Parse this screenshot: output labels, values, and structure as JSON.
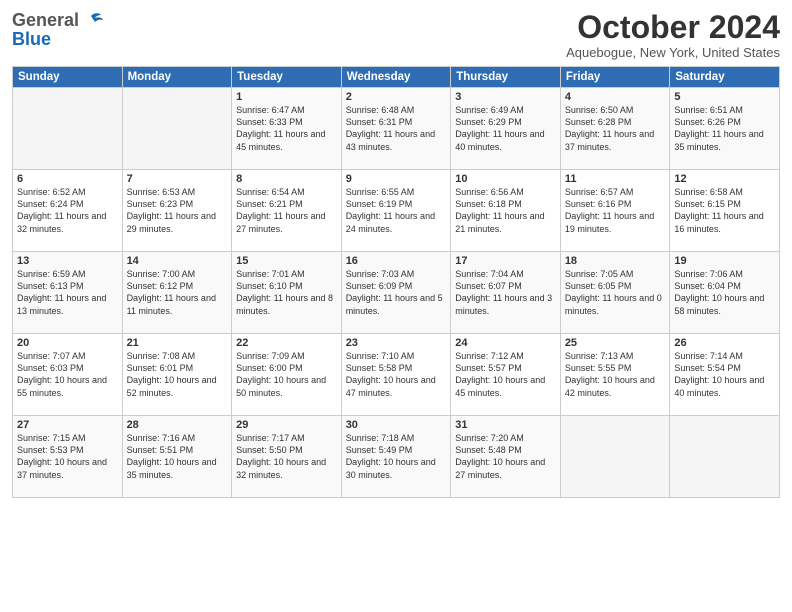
{
  "header": {
    "logo_general": "General",
    "logo_blue": "Blue",
    "month_title": "October 2024",
    "location": "Aquebogue, New York, United States"
  },
  "days_of_week": [
    "Sunday",
    "Monday",
    "Tuesday",
    "Wednesday",
    "Thursday",
    "Friday",
    "Saturday"
  ],
  "weeks": [
    [
      {
        "day": "",
        "sunrise": "",
        "sunset": "",
        "daylight": ""
      },
      {
        "day": "",
        "sunrise": "",
        "sunset": "",
        "daylight": ""
      },
      {
        "day": "1",
        "sunrise": "Sunrise: 6:47 AM",
        "sunset": "Sunset: 6:33 PM",
        "daylight": "Daylight: 11 hours and 45 minutes."
      },
      {
        "day": "2",
        "sunrise": "Sunrise: 6:48 AM",
        "sunset": "Sunset: 6:31 PM",
        "daylight": "Daylight: 11 hours and 43 minutes."
      },
      {
        "day": "3",
        "sunrise": "Sunrise: 6:49 AM",
        "sunset": "Sunset: 6:29 PM",
        "daylight": "Daylight: 11 hours and 40 minutes."
      },
      {
        "day": "4",
        "sunrise": "Sunrise: 6:50 AM",
        "sunset": "Sunset: 6:28 PM",
        "daylight": "Daylight: 11 hours and 37 minutes."
      },
      {
        "day": "5",
        "sunrise": "Sunrise: 6:51 AM",
        "sunset": "Sunset: 6:26 PM",
        "daylight": "Daylight: 11 hours and 35 minutes."
      }
    ],
    [
      {
        "day": "6",
        "sunrise": "Sunrise: 6:52 AM",
        "sunset": "Sunset: 6:24 PM",
        "daylight": "Daylight: 11 hours and 32 minutes."
      },
      {
        "day": "7",
        "sunrise": "Sunrise: 6:53 AM",
        "sunset": "Sunset: 6:23 PM",
        "daylight": "Daylight: 11 hours and 29 minutes."
      },
      {
        "day": "8",
        "sunrise": "Sunrise: 6:54 AM",
        "sunset": "Sunset: 6:21 PM",
        "daylight": "Daylight: 11 hours and 27 minutes."
      },
      {
        "day": "9",
        "sunrise": "Sunrise: 6:55 AM",
        "sunset": "Sunset: 6:19 PM",
        "daylight": "Daylight: 11 hours and 24 minutes."
      },
      {
        "day": "10",
        "sunrise": "Sunrise: 6:56 AM",
        "sunset": "Sunset: 6:18 PM",
        "daylight": "Daylight: 11 hours and 21 minutes."
      },
      {
        "day": "11",
        "sunrise": "Sunrise: 6:57 AM",
        "sunset": "Sunset: 6:16 PM",
        "daylight": "Daylight: 11 hours and 19 minutes."
      },
      {
        "day": "12",
        "sunrise": "Sunrise: 6:58 AM",
        "sunset": "Sunset: 6:15 PM",
        "daylight": "Daylight: 11 hours and 16 minutes."
      }
    ],
    [
      {
        "day": "13",
        "sunrise": "Sunrise: 6:59 AM",
        "sunset": "Sunset: 6:13 PM",
        "daylight": "Daylight: 11 hours and 13 minutes."
      },
      {
        "day": "14",
        "sunrise": "Sunrise: 7:00 AM",
        "sunset": "Sunset: 6:12 PM",
        "daylight": "Daylight: 11 hours and 11 minutes."
      },
      {
        "day": "15",
        "sunrise": "Sunrise: 7:01 AM",
        "sunset": "Sunset: 6:10 PM",
        "daylight": "Daylight: 11 hours and 8 minutes."
      },
      {
        "day": "16",
        "sunrise": "Sunrise: 7:03 AM",
        "sunset": "Sunset: 6:09 PM",
        "daylight": "Daylight: 11 hours and 5 minutes."
      },
      {
        "day": "17",
        "sunrise": "Sunrise: 7:04 AM",
        "sunset": "Sunset: 6:07 PM",
        "daylight": "Daylight: 11 hours and 3 minutes."
      },
      {
        "day": "18",
        "sunrise": "Sunrise: 7:05 AM",
        "sunset": "Sunset: 6:05 PM",
        "daylight": "Daylight: 11 hours and 0 minutes."
      },
      {
        "day": "19",
        "sunrise": "Sunrise: 7:06 AM",
        "sunset": "Sunset: 6:04 PM",
        "daylight": "Daylight: 10 hours and 58 minutes."
      }
    ],
    [
      {
        "day": "20",
        "sunrise": "Sunrise: 7:07 AM",
        "sunset": "Sunset: 6:03 PM",
        "daylight": "Daylight: 10 hours and 55 minutes."
      },
      {
        "day": "21",
        "sunrise": "Sunrise: 7:08 AM",
        "sunset": "Sunset: 6:01 PM",
        "daylight": "Daylight: 10 hours and 52 minutes."
      },
      {
        "day": "22",
        "sunrise": "Sunrise: 7:09 AM",
        "sunset": "Sunset: 6:00 PM",
        "daylight": "Daylight: 10 hours and 50 minutes."
      },
      {
        "day": "23",
        "sunrise": "Sunrise: 7:10 AM",
        "sunset": "Sunset: 5:58 PM",
        "daylight": "Daylight: 10 hours and 47 minutes."
      },
      {
        "day": "24",
        "sunrise": "Sunrise: 7:12 AM",
        "sunset": "Sunset: 5:57 PM",
        "daylight": "Daylight: 10 hours and 45 minutes."
      },
      {
        "day": "25",
        "sunrise": "Sunrise: 7:13 AM",
        "sunset": "Sunset: 5:55 PM",
        "daylight": "Daylight: 10 hours and 42 minutes."
      },
      {
        "day": "26",
        "sunrise": "Sunrise: 7:14 AM",
        "sunset": "Sunset: 5:54 PM",
        "daylight": "Daylight: 10 hours and 40 minutes."
      }
    ],
    [
      {
        "day": "27",
        "sunrise": "Sunrise: 7:15 AM",
        "sunset": "Sunset: 5:53 PM",
        "daylight": "Daylight: 10 hours and 37 minutes."
      },
      {
        "day": "28",
        "sunrise": "Sunrise: 7:16 AM",
        "sunset": "Sunset: 5:51 PM",
        "daylight": "Daylight: 10 hours and 35 minutes."
      },
      {
        "day": "29",
        "sunrise": "Sunrise: 7:17 AM",
        "sunset": "Sunset: 5:50 PM",
        "daylight": "Daylight: 10 hours and 32 minutes."
      },
      {
        "day": "30",
        "sunrise": "Sunrise: 7:18 AM",
        "sunset": "Sunset: 5:49 PM",
        "daylight": "Daylight: 10 hours and 30 minutes."
      },
      {
        "day": "31",
        "sunrise": "Sunrise: 7:20 AM",
        "sunset": "Sunset: 5:48 PM",
        "daylight": "Daylight: 10 hours and 27 minutes."
      },
      {
        "day": "",
        "sunrise": "",
        "sunset": "",
        "daylight": ""
      },
      {
        "day": "",
        "sunrise": "",
        "sunset": "",
        "daylight": ""
      }
    ]
  ]
}
